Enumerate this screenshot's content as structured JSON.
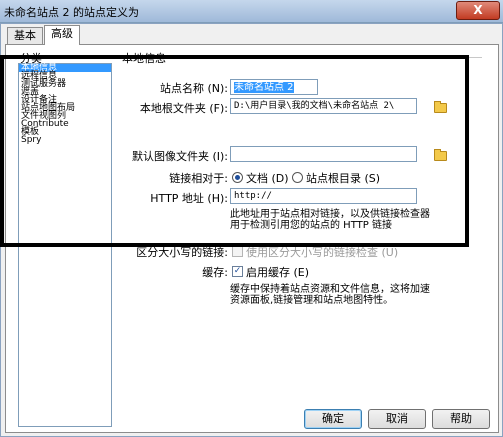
{
  "window": {
    "title": "未命名站点 2 的站点定义为",
    "close_label": "X"
  },
  "tabs": [
    {
      "label": "基本"
    },
    {
      "label": "高级"
    }
  ],
  "categories": {
    "header": "分类",
    "items": [
      "本地信息",
      "远程信息",
      "测试服务器",
      "遮盖",
      "设计备注",
      "站点地图布局",
      "文件视图列",
      "Contribute",
      "模板",
      "Spry"
    ],
    "selected": "本地信息"
  },
  "local_info": {
    "section_title": "本地信息",
    "site_name_label": "站点名称 (N):",
    "site_name_value": "未命名站点 2",
    "local_root_label": "本地根文件夹 (F):",
    "local_root_value": "D:\\用户目录\\我的文档\\未命名站点 2\\",
    "default_images_label": "默认图像文件夹 (I):",
    "default_images_value": "",
    "links_relative_label": "链接相对于:",
    "radio_document": "文档 (D)",
    "radio_site_root": "站点根目录 (S)",
    "http_label": "HTTP 地址 (H):",
    "http_value": "http://",
    "http_note": "此地址用于站点相对链接，以及供链接检查器用于检测引用您的站点的 HTTP 链接",
    "case_label": "区分大小写的链接:",
    "case_option": "使用区分大小写的链接检查 (U)",
    "cache_label": "缓存:",
    "cache_option": "启用缓存 (E)",
    "cache_note": "缓存中保持着站点资源和文件信息，这将加速资源面板,链接管理和站点地图特性。"
  },
  "buttons": {
    "ok": "确定",
    "cancel": "取消",
    "help": "帮助"
  }
}
